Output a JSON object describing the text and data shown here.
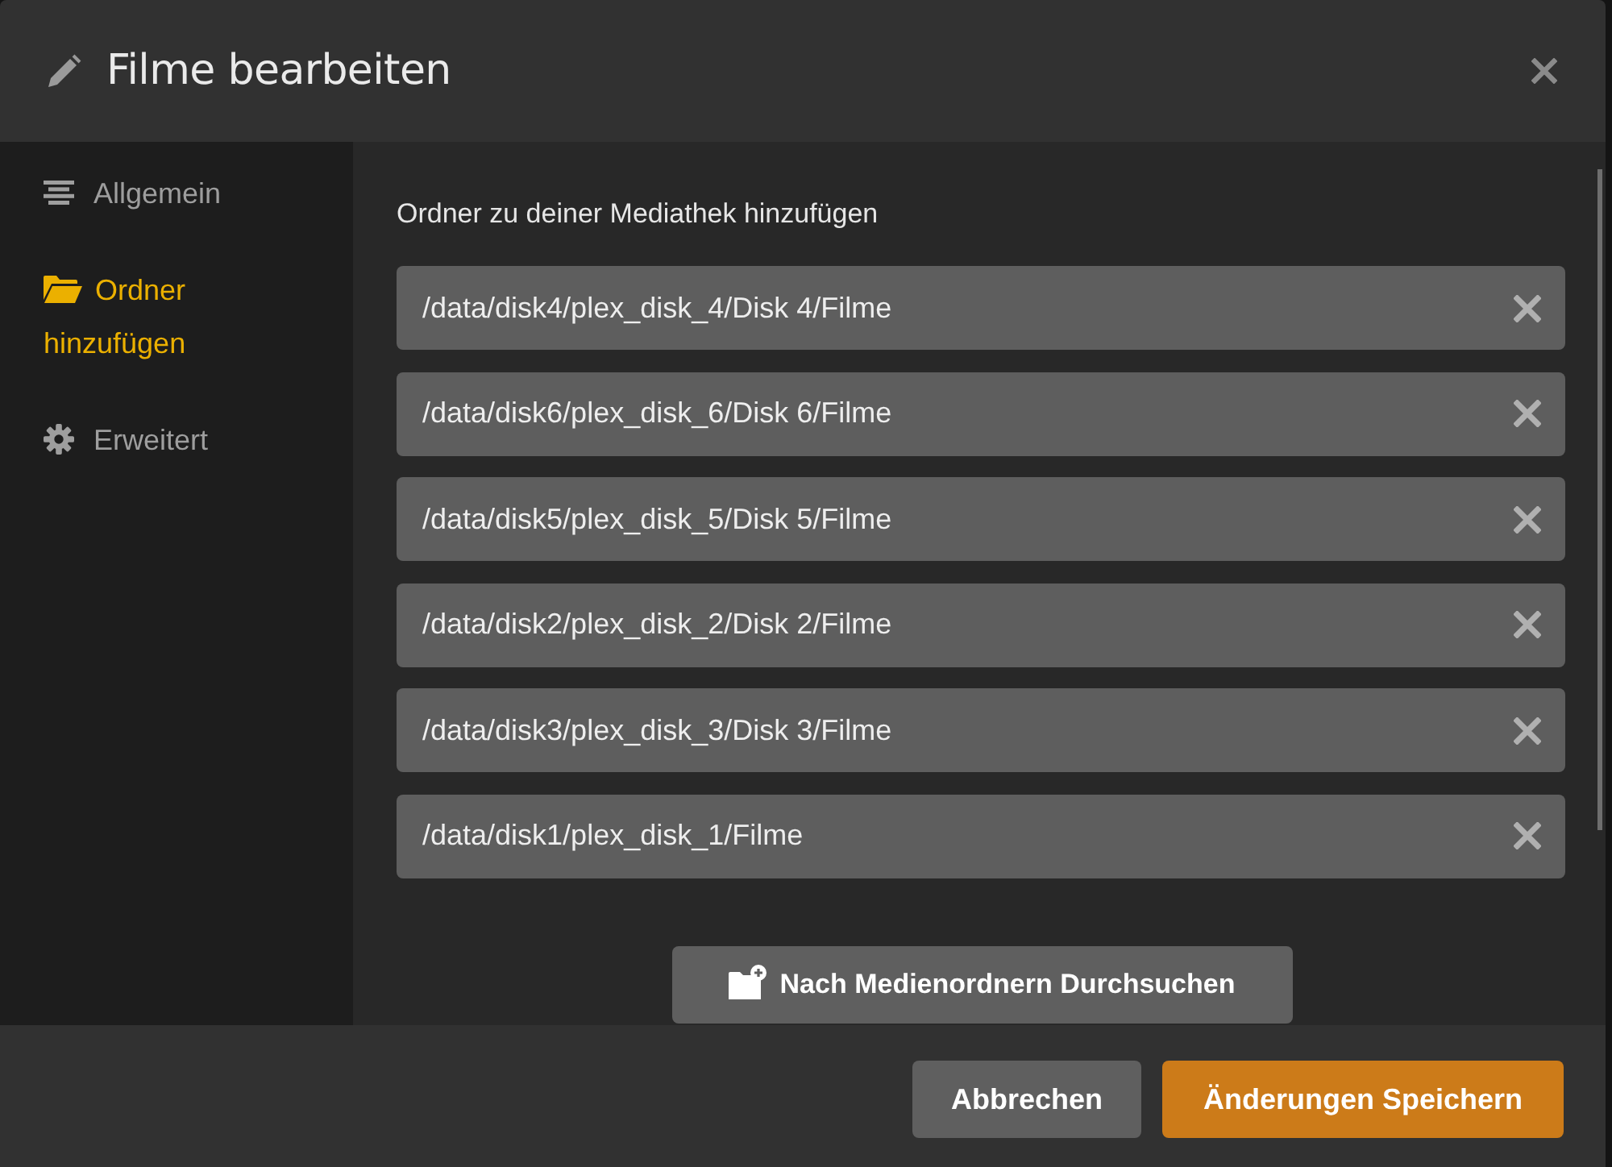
{
  "window": {
    "title": "Filme bearbeiten"
  },
  "sidebar": {
    "items": [
      {
        "label": "Allgemein",
        "selected": false
      },
      {
        "label": "Ordner hinzufügen",
        "selected": true
      },
      {
        "label": "Erweitert",
        "selected": false
      }
    ]
  },
  "content": {
    "heading": "Ordner zu deiner Mediathek hinzufügen",
    "folders": [
      {
        "path": "/data/disk4/plex_disk_4/Disk 4/Filme"
      },
      {
        "path": "/data/disk6/plex_disk_6/Disk 6/Filme"
      },
      {
        "path": "/data/disk5/plex_disk_5/Disk 5/Filme"
      },
      {
        "path": "/data/disk2/plex_disk_2/Disk 2/Filme"
      },
      {
        "path": "/data/disk3/plex_disk_3/Disk 3/Filme"
      },
      {
        "path": "/data/disk1/plex_disk_1/Filme"
      }
    ],
    "browse_button": {
      "label": "Nach Medienordnern Durchsuchen"
    }
  },
  "footer": {
    "buttons": [
      {
        "label": "Abbrechen",
        "kind": "secondary"
      },
      {
        "label": "Änderungen Speichern",
        "kind": "primary"
      }
    ]
  }
}
